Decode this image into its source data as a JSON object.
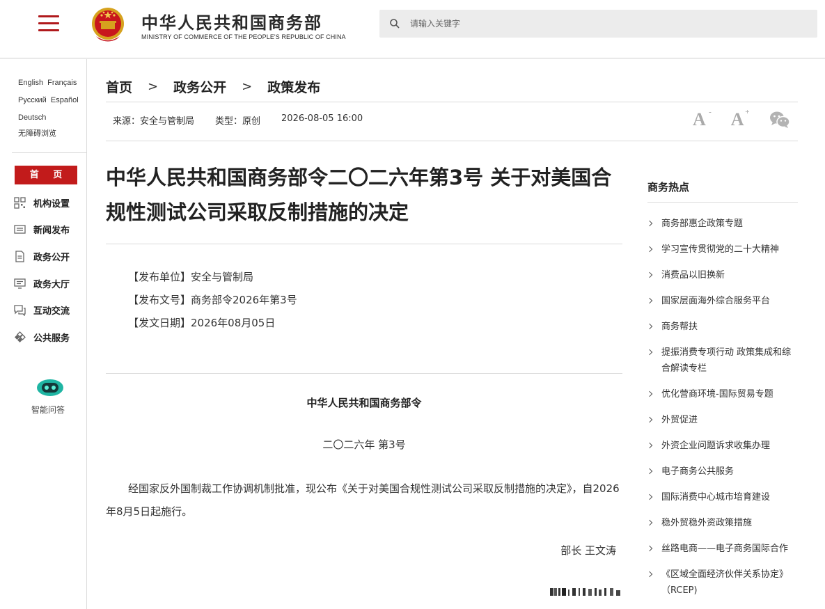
{
  "header": {
    "site_name_cn": "中华人民共和国商务部",
    "site_name_en": "MINISTRY OF COMMERCE OF THE PEOPLE'S REPUBLIC OF CHINA",
    "search_placeholder": "请输入关键字",
    "brand_color": "#b0191c"
  },
  "sidebar": {
    "languages": [
      "English",
      "Français",
      "Русский",
      "Español",
      "Deutsch"
    ],
    "accessibility": "无障碍浏览",
    "home_label": "首 页",
    "items": [
      {
        "label": "机构设置",
        "icon": "grid-icon"
      },
      {
        "label": "新闻发布",
        "icon": "news-icon"
      },
      {
        "label": "政务公开",
        "icon": "document-icon"
      },
      {
        "label": "政务大厅",
        "icon": "monitor-icon"
      },
      {
        "label": "互动交流",
        "icon": "chat-icon"
      },
      {
        "label": "公共服务",
        "icon": "service-icon"
      }
    ],
    "assistant_label": "智能问答"
  },
  "breadcrumb": [
    "首页",
    "政务公开",
    "政策发布"
  ],
  "meta": {
    "source": "来源：安全与管制局",
    "type": "类型：原创",
    "datetime": "2026-08-05 16:00"
  },
  "article": {
    "title": "中华人民共和国商务部令二〇二六年第3号 关于对美国合规性测试公司采取反制措施的决定",
    "issuer": "【发布单位】安全与管制局",
    "doc_number": "【发布文号】商务部令2026年第3号",
    "issue_date": "【发文日期】2026年08月05日",
    "doc_header": "中华人民共和国商务部令",
    "doc_number_line": "二〇二六年 第3号",
    "paragraph": "经国家反外国制裁工作协调机制批准，现公布《关于对美国合规性测试公司采取反制措施的决定》，自2026年8月5日起施行。",
    "signature": "部长 王文涛"
  },
  "hotspot": {
    "title": "商务热点",
    "items": [
      "商务部惠企政策专题",
      "学习宣传贯彻党的二十大精神",
      "消费品以旧换新",
      "国家层面海外综合服务平台",
      "商务帮扶",
      "提振消费专项行动 政策集成和综合解读专栏",
      "优化营商环境-国际贸易专题",
      "外贸促进",
      "外资企业问题诉求收集办理",
      "电子商务公共服务",
      "国际消费中心城市培育建设",
      "稳外贸稳外资政策措施",
      "丝路电商——电子商务国际合作",
      "《区域全面经济伙伴关系协定》（RCEP)"
    ]
  }
}
